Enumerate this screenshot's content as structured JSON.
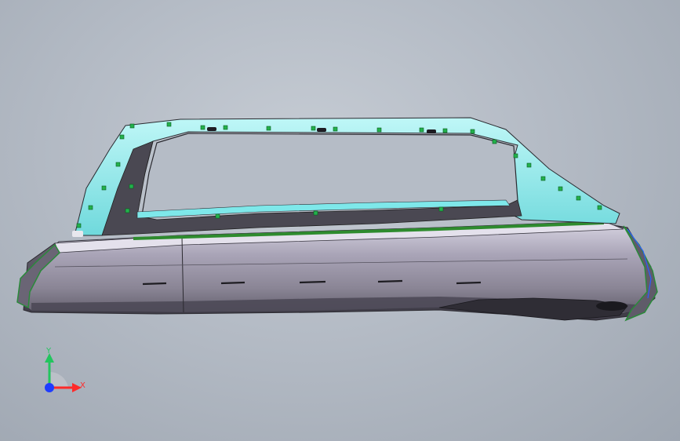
{
  "viewport": {
    "background_top": "#c6ccd4",
    "background_bottom": "#9ea6b1"
  },
  "model": {
    "body_color": "#8f8a98",
    "frame_color": "#7ee8ea",
    "seal_color": "#2e8b2e",
    "marker_color": "#22b14c"
  },
  "triad": {
    "x_label": "X",
    "y_label": "Y",
    "x_color": "#ff2a2a",
    "y_color": "#22c55e",
    "z_color": "#1e3cff"
  }
}
